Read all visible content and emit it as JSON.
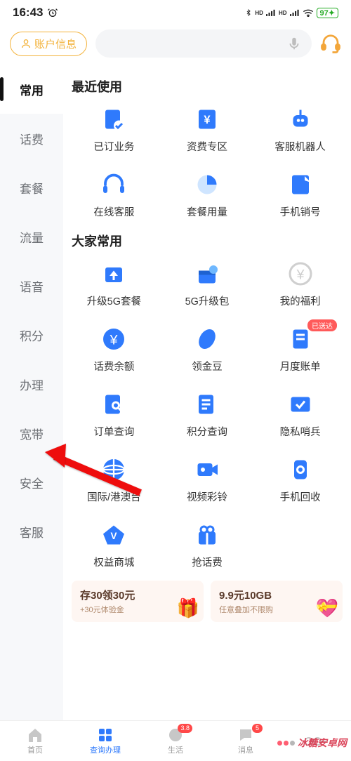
{
  "status": {
    "time": "16:43",
    "battery": "97"
  },
  "topbar": {
    "account_label": "账户信息"
  },
  "sidebar": {
    "items": [
      {
        "label": "常用",
        "key": "common"
      },
      {
        "label": "话费",
        "key": "balance"
      },
      {
        "label": "套餐",
        "key": "plan"
      },
      {
        "label": "流量",
        "key": "data"
      },
      {
        "label": "语音",
        "key": "voice"
      },
      {
        "label": "积分",
        "key": "points"
      },
      {
        "label": "办理",
        "key": "handle"
      },
      {
        "label": "宽带",
        "key": "broadband"
      },
      {
        "label": "安全",
        "key": "security"
      },
      {
        "label": "客服",
        "key": "service"
      }
    ],
    "active_index": 0
  },
  "sections": {
    "recent": {
      "title": "最近使用",
      "items": [
        {
          "label": "已订业务",
          "icon": "doc-check"
        },
        {
          "label": "资费专区",
          "icon": "price-tag"
        },
        {
          "label": "客服机器人",
          "icon": "robot"
        },
        {
          "label": "在线客服",
          "icon": "headset"
        },
        {
          "label": "套餐用量",
          "icon": "pie"
        },
        {
          "label": "手机销号",
          "icon": "cancel"
        }
      ]
    },
    "popular": {
      "title": "大家常用",
      "items": [
        {
          "label": "升级5G套餐",
          "icon": "upgrade"
        },
        {
          "label": "5G升级包",
          "icon": "gift-g"
        },
        {
          "label": "我的福利",
          "icon": "yen-circle",
          "gray": true
        },
        {
          "label": "话费余额",
          "icon": "yen-solid"
        },
        {
          "label": "领金豆",
          "icon": "bean"
        },
        {
          "label": "月度账单",
          "icon": "bill",
          "badge": "已送达"
        },
        {
          "label": "订单查询",
          "icon": "search-doc"
        },
        {
          "label": "积分查询",
          "icon": "list-doc"
        },
        {
          "label": "隐私哨兵",
          "icon": "shield"
        },
        {
          "label": "国际/港澳台",
          "icon": "globe"
        },
        {
          "label": "视频彩铃",
          "icon": "video"
        },
        {
          "label": "手机回收",
          "icon": "recycle"
        },
        {
          "label": "权益商城",
          "icon": "vip"
        },
        {
          "label": "抢话费",
          "icon": "gift"
        }
      ]
    }
  },
  "promos": [
    {
      "title": "存30领30元",
      "sub": "+30元体验金"
    },
    {
      "title": "9.9元10GB",
      "sub": "任意叠加不限购"
    }
  ],
  "nav": {
    "items": [
      {
        "label": "首页"
      },
      {
        "label": "查询办理",
        "active": true
      },
      {
        "label": "生活",
        "dot": "3.8"
      },
      {
        "label": "消息",
        "dot": "5"
      },
      {
        "label": ""
      }
    ]
  },
  "watermark": "冰糖安卓网"
}
